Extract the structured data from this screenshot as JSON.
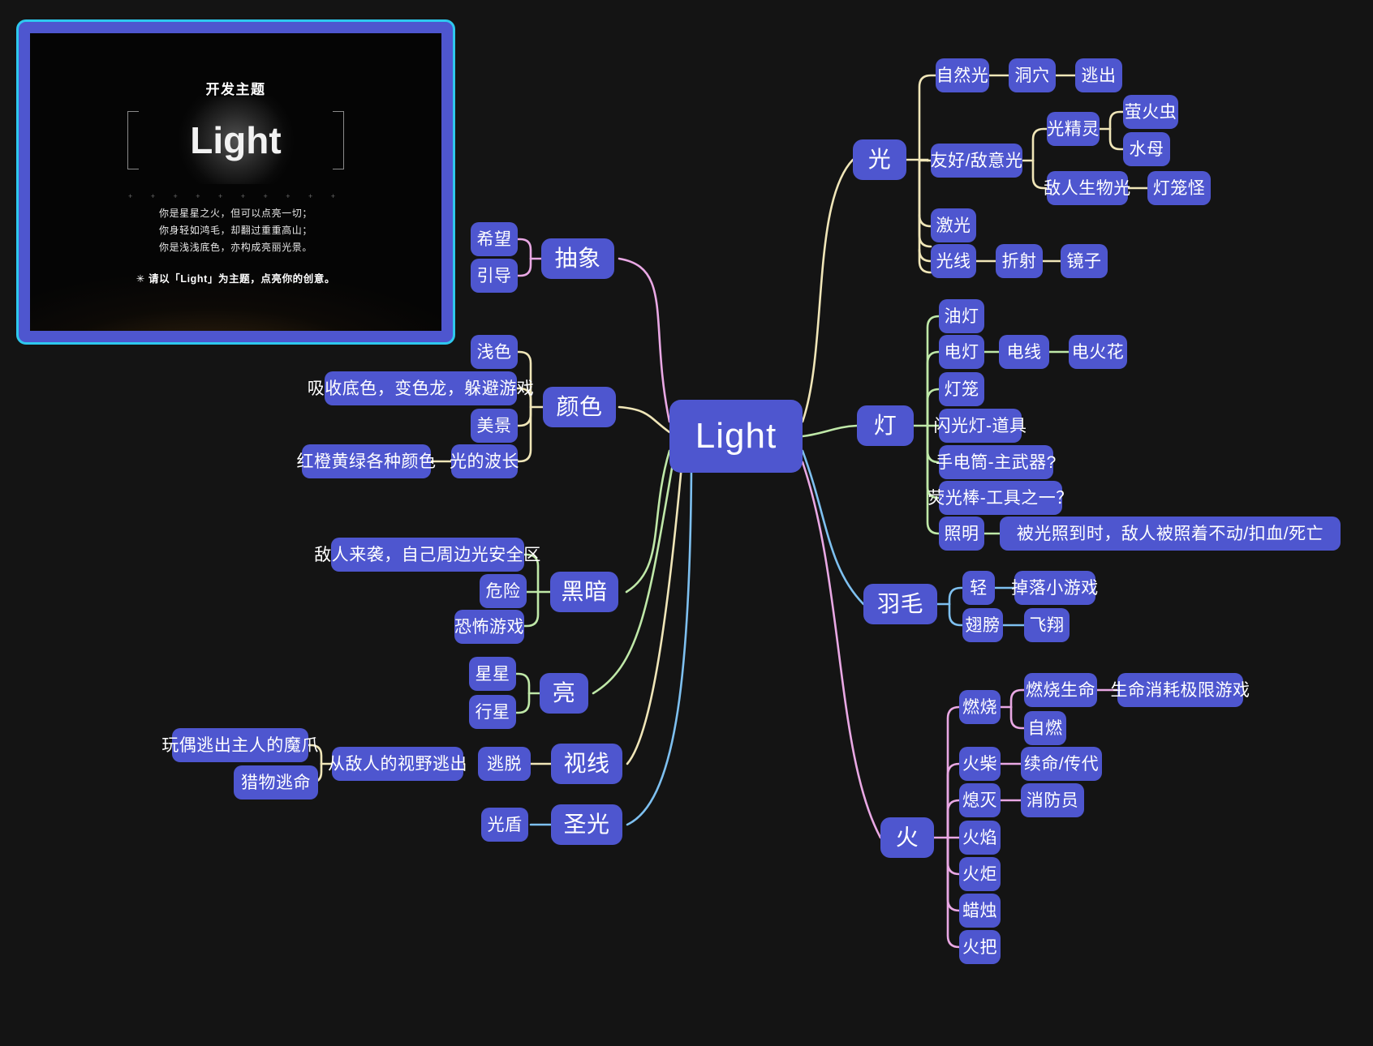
{
  "poster": {
    "heading": "开发主题",
    "word": "Light",
    "dots": "+ + + + + + + + + +",
    "line1": "你是星星之火，但可以点亮一切；",
    "line2": "你身轻如鸿毛，却翻过重重高山；",
    "line3": "你是浅浅底色，亦构成亮丽光景。",
    "note": "✳ 请以「Light」为主题，点亮你的创意。"
  },
  "colors": {
    "node": "#4e56cf",
    "canvas": "#141414",
    "edge_cream": "#f0e6b8",
    "edge_green": "#bfe8a8",
    "edge_blue": "#7ec0f0",
    "edge_pink": "#e9a8e4",
    "poster_border": "#2ec8ee"
  },
  "mindmap": {
    "root": "Light",
    "branches": [
      {
        "label": "光",
        "color": "#f0e6b8",
        "children": [
          {
            "label": "自然光",
            "children": [
              {
                "label": "洞穴",
                "children": [
                  {
                    "label": "逃出"
                  }
                ]
              }
            ]
          },
          {
            "label": "友好/敌意光",
            "children": [
              {
                "label": "光精灵",
                "children": [
                  {
                    "label": "萤火虫"
                  },
                  {
                    "label": "水母"
                  }
                ]
              },
              {
                "label": "敌人生物光",
                "children": [
                  {
                    "label": "灯笼怪"
                  }
                ]
              }
            ]
          },
          {
            "label": "激光"
          },
          {
            "label": "光线",
            "children": [
              {
                "label": "折射",
                "children": [
                  {
                    "label": "镜子"
                  }
                ]
              }
            ]
          }
        ]
      },
      {
        "label": "灯",
        "color": "#bfe8a8",
        "children": [
          {
            "label": "油灯"
          },
          {
            "label": "电灯",
            "children": [
              {
                "label": "电线",
                "children": [
                  {
                    "label": "电火花"
                  }
                ]
              }
            ]
          },
          {
            "label": "灯笼"
          },
          {
            "label": "闪光灯-道具"
          },
          {
            "label": "手电筒-主武器?"
          },
          {
            "label": "荧光棒-工具之一？"
          },
          {
            "label": "照明",
            "children": [
              {
                "label": "被光照到时，敌人被照着不动/扣血/死亡"
              }
            ]
          }
        ]
      },
      {
        "label": "羽毛",
        "color": "#7ec0f0",
        "children": [
          {
            "label": "轻",
            "children": [
              {
                "label": "掉落小游戏"
              }
            ]
          },
          {
            "label": "翅膀",
            "children": [
              {
                "label": "飞翔"
              }
            ]
          }
        ]
      },
      {
        "label": "火",
        "color": "#e9a8e4",
        "children": [
          {
            "label": "燃烧",
            "children": [
              {
                "label": "燃烧生命",
                "children": [
                  {
                    "label": "生命消耗极限游戏"
                  }
                ]
              },
              {
                "label": "自燃"
              }
            ]
          },
          {
            "label": "火柴",
            "children": [
              {
                "label": "续命/传代"
              }
            ]
          },
          {
            "label": "熄灭",
            "children": [
              {
                "label": "消防员"
              }
            ]
          },
          {
            "label": "火焰"
          },
          {
            "label": "火炬"
          },
          {
            "label": "蜡烛"
          },
          {
            "label": "火把"
          }
        ]
      },
      {
        "label": "抽象",
        "color": "#e9a8e4",
        "children": [
          {
            "label": "希望"
          },
          {
            "label": "引导"
          }
        ]
      },
      {
        "label": "颜色",
        "color": "#f0e6b8",
        "children": [
          {
            "label": "浅色"
          },
          {
            "label": "吸收底色，变色龙，躲避游戏"
          },
          {
            "label": "美景"
          },
          {
            "label": "光的波长",
            "children": [
              {
                "label": "红橙黄绿各种颜色"
              }
            ]
          }
        ]
      },
      {
        "label": "黑暗",
        "color": "#bfe8a8",
        "children": [
          {
            "label": "敌人来袭，自己周边光安全区"
          },
          {
            "label": "危险"
          },
          {
            "label": "恐怖游戏"
          }
        ]
      },
      {
        "label": "亮",
        "color": "#bfe8a8",
        "children": [
          {
            "label": "星星"
          },
          {
            "label": "行星"
          }
        ]
      },
      {
        "label": "视线",
        "color": "#f0e6b8",
        "children": [
          {
            "label": "逃脱",
            "children": [
              {
                "label": "从敌人的视野逃出",
                "children": [
                  {
                    "label": "玩偶逃出主人的魔爪"
                  },
                  {
                    "label": "猎物逃命"
                  }
                ]
              }
            ]
          }
        ]
      },
      {
        "label": "圣光",
        "color": "#7ec0f0",
        "children": [
          {
            "label": "光盾"
          }
        ]
      }
    ]
  },
  "nodes": {
    "root": "Light",
    "guang": "光",
    "ziranguang": "自然光",
    "dongxue": "洞穴",
    "taochu": "逃出",
    "youhao": "友好/敌意光",
    "guangjingling": "光精灵",
    "yinghuochong": "萤火虫",
    "shuimu": "水母",
    "direnshengwuguang": "敌人生物光",
    "denglongguai": "灯笼怪",
    "jiguang": "激光",
    "guangxian": "光线",
    "zheshe": "折射",
    "jingzi": "镜子",
    "deng": "灯",
    "youdeng": "油灯",
    "diandeng": "电灯",
    "dianxian": "电线",
    "dianhuohua": "电火花",
    "denglong": "灯笼",
    "shanguangdeng": "闪光灯-道具",
    "shoudiantong": "手电筒-主武器?",
    "yingguangbang": "荧光棒-工具之一？",
    "zhaoming": "照明",
    "zhaomingdesc": "被光照到时，敌人被照着不动/扣血/死亡",
    "yumao": "羽毛",
    "qing": "轻",
    "diaoluo": "掉落小游戏",
    "chibang": "翅膀",
    "feixiang": "飞翔",
    "huo": "火",
    "ranshao": "燃烧",
    "ranshaoshengming": "燃烧生命",
    "shengmingxiaohao": "生命消耗极限游戏",
    "ziran": "自燃",
    "huochai": "火柴",
    "xuming": "续命/传代",
    "ximie": "熄灭",
    "xiaofangyuan": "消防员",
    "huoyan": "火焰",
    "huoju": "火炬",
    "lazhu": "蜡烛",
    "huoba": "火把",
    "chouxiang": "抽象",
    "xiwang": "希望",
    "yindao": "引导",
    "yanse": "颜色",
    "qianse": "浅色",
    "xishoudise": "吸收底色，变色龙，躲避游戏",
    "meijing": "美景",
    "guangdebochang": "光的波长",
    "hongchenghuanglv": "红橙黄绿各种颜色",
    "heian": "黑暗",
    "direnlaixi": "敌人来袭，自己周边光安全区",
    "weixian": "危险",
    "kongbuyouxi": "恐怖游戏",
    "liang": "亮",
    "xingxing": "星星",
    "xingxing2": "行星",
    "shixian": "视线",
    "taotuo": "逃脱",
    "congdirentaochu": "从敌人的视野逃出",
    "wanou": "玩偶逃出主人的魔爪",
    "liewu": "猎物逃命",
    "shengguang": "圣光",
    "guangdun": "光盾"
  }
}
